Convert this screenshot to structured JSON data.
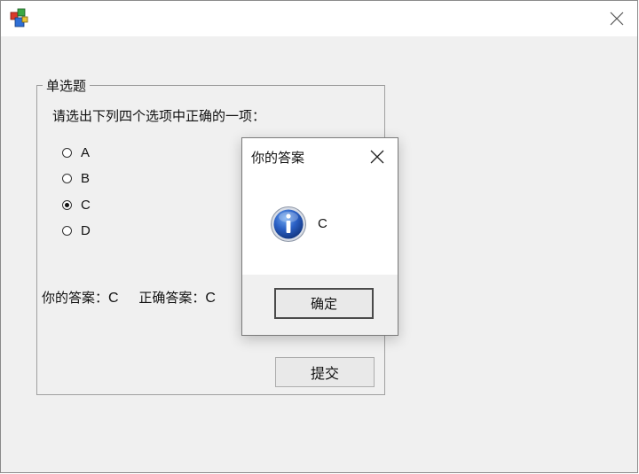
{
  "main_window": {
    "app_icon": "colored-blocks-icon",
    "close_icon": "close-icon"
  },
  "quiz": {
    "group_label": "单选题",
    "question": "请选出下列四个选项中正确的一项：",
    "options": [
      {
        "label": "A",
        "checked": false
      },
      {
        "label": "B",
        "checked": false
      },
      {
        "label": "C",
        "checked": true
      },
      {
        "label": "D",
        "checked": false
      }
    ],
    "your_answer_label": "你的答案：",
    "your_answer_value": "C",
    "correct_answer_label": "正确答案：",
    "correct_answer_value": "C",
    "submit_label": "提交"
  },
  "dialog": {
    "title": "你的答案",
    "icon": "info-icon",
    "message": "C",
    "ok_label": "确定",
    "close_icon": "close-icon"
  },
  "colors": {
    "window_bg": "#f0f0f0",
    "info_icon_blue": "#1f4fa8"
  }
}
